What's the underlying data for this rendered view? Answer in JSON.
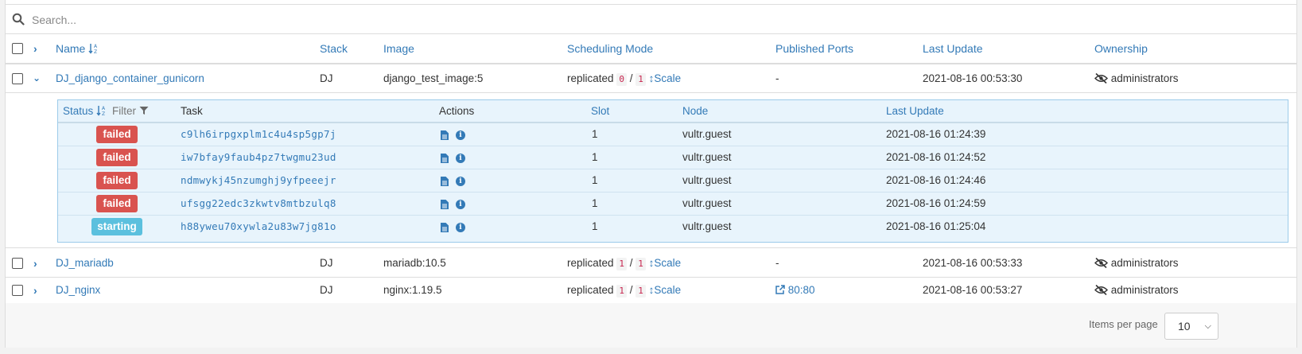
{
  "search": {
    "placeholder": "Search..."
  },
  "headers": {
    "name": "Name",
    "stack": "Stack",
    "image": "Image",
    "scheduling": "Scheduling Mode",
    "ports": "Published Ports",
    "last_update": "Last Update",
    "ownership": "Ownership"
  },
  "services": [
    {
      "name": "DJ_django_container_gunicorn",
      "stack": "DJ",
      "image": "django_test_image:5",
      "mode": "replicated",
      "running": "0",
      "sep": "/",
      "total": "1",
      "scale": "Scale",
      "ports": "-",
      "updated": "2021-08-16 00:53:30",
      "owner": "administrators"
    },
    {
      "name": "DJ_mariadb",
      "stack": "DJ",
      "image": "mariadb:10.5",
      "mode": "replicated",
      "running": "1",
      "sep": "/",
      "total": "1",
      "scale": "Scale",
      "ports": "-",
      "updated": "2021-08-16 00:53:33",
      "owner": "administrators"
    },
    {
      "name": "DJ_nginx",
      "stack": "DJ",
      "image": "nginx:1.19.5",
      "mode": "replicated",
      "running": "1",
      "sep": "/",
      "total": "1",
      "scale": "Scale",
      "ports": "80:80",
      "updated": "2021-08-16 00:53:27",
      "owner": "administrators"
    }
  ],
  "task_headers": {
    "status": "Status",
    "filter": "Filter",
    "task": "Task",
    "actions": "Actions",
    "slot": "Slot",
    "node": "Node",
    "last_update": "Last Update"
  },
  "tasks": [
    {
      "status": "failed",
      "id": "c9lh6irpgxplm1c4u4sp5gp7j",
      "slot": "1",
      "node": "vultr.guest",
      "updated": "2021-08-16 01:24:39"
    },
    {
      "status": "failed",
      "id": "iw7bfay9faub4pz7twgmu23ud",
      "slot": "1",
      "node": "vultr.guest",
      "updated": "2021-08-16 01:24:52"
    },
    {
      "status": "failed",
      "id": "ndmwykj45nzumghj9yfpeeejr",
      "slot": "1",
      "node": "vultr.guest",
      "updated": "2021-08-16 01:24:46"
    },
    {
      "status": "failed",
      "id": "ufsgg22edc3zkwtv8mtbzulq8",
      "slot": "1",
      "node": "vultr.guest",
      "updated": "2021-08-16 01:24:59"
    },
    {
      "status": "starting",
      "id": "h88yweu70xywla2u83w7jg81o",
      "slot": "1",
      "node": "vultr.guest",
      "updated": "2021-08-16 01:25:04"
    }
  ],
  "pagination": {
    "label": "Items per page",
    "value": "10"
  },
  "colors": {
    "link": "#337ab7",
    "failed": "#d9534f",
    "starting": "#5bc0de",
    "count": "#c7254e"
  }
}
